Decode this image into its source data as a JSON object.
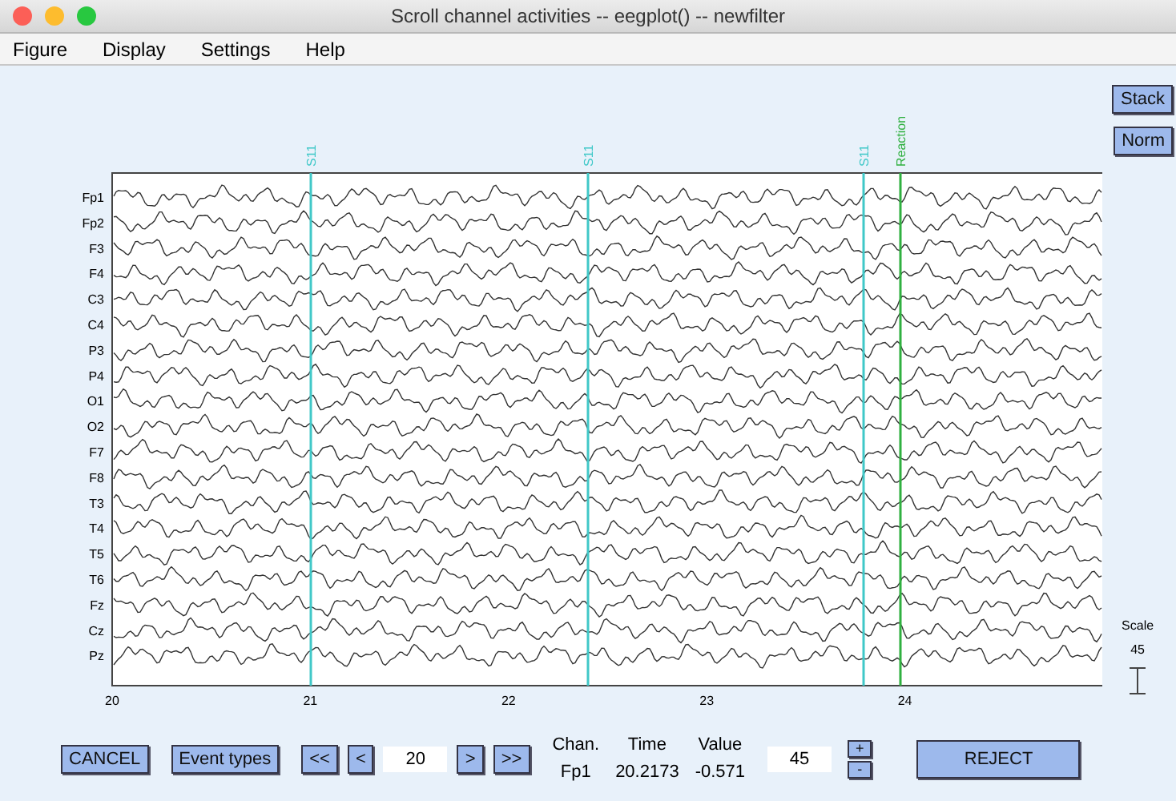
{
  "window": {
    "title": "Scroll channel activities -- eegplot() -- newfilter"
  },
  "menu": [
    "Figure",
    "Display",
    "Settings",
    "Help"
  ],
  "side_buttons": [
    "Stack",
    "Norm"
  ],
  "plot": {
    "channels": [
      "Fp1",
      "Fp2",
      "F3",
      "F4",
      "C3",
      "C4",
      "P3",
      "P4",
      "O1",
      "O2",
      "F7",
      "F8",
      "T3",
      "T4",
      "T5",
      "T6",
      "Fz",
      "Cz",
      "Pz"
    ],
    "xticks": [
      "20",
      "21",
      "22",
      "23",
      "24"
    ],
    "events": [
      {
        "label": "S11",
        "color": "#40c8c8"
      },
      {
        "label": "S11",
        "color": "#40c8c8"
      },
      {
        "label": "S11",
        "color": "#40c8c8"
      },
      {
        "label": "Reaction",
        "color": "#30b040"
      }
    ]
  },
  "scale": {
    "label": "Scale",
    "value": "45"
  },
  "controls": {
    "cancel": "CANCEL",
    "event_types": "Event types",
    "nav": [
      "<<",
      "<",
      ">",
      ">>"
    ],
    "time_field": "20",
    "readout": {
      "headers": [
        "Chan.",
        "Time",
        "Value"
      ],
      "values": [
        "Fp1",
        "20.2173",
        "-0.571"
      ]
    },
    "scale_field": "45",
    "steps": [
      "+",
      "-"
    ],
    "reject": "REJECT"
  }
}
